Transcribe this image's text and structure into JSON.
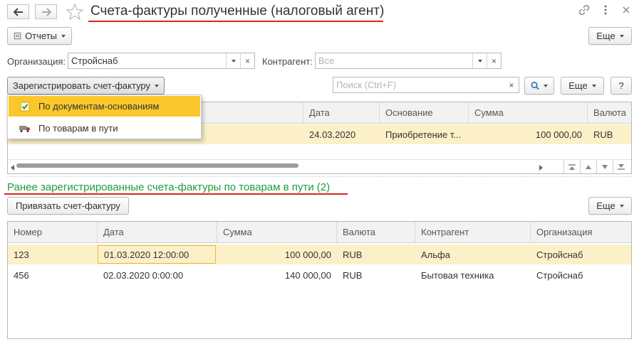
{
  "header": {
    "title": "Счета-фактуры полученные (налоговый агент)"
  },
  "toolbar1": {
    "reports_label": "Отчеты",
    "more_label": "Еще"
  },
  "filters": {
    "org_label": "Организация:",
    "org_value": "Стройснаб",
    "contractor_label": "Контрагент:",
    "contractor_placeholder": "Все"
  },
  "toolbar2": {
    "register_label": "Зарегистрировать счет-фактуру",
    "search_placeholder": "Поиск (Ctrl+F)",
    "more_label": "Еще",
    "help_label": "?"
  },
  "dropdown": {
    "items": [
      {
        "label": "По документам-основаниям",
        "icon": "check-doc-icon"
      },
      {
        "label": "По товарам в пути",
        "icon": "truck-icon"
      }
    ]
  },
  "grid1": {
    "columns": [
      "Дата",
      "Основание",
      "Сумма",
      "Валюта"
    ],
    "rows": [
      {
        "date": "24.03.2020",
        "basis": "Приобретение т...",
        "sum": "100 000,00",
        "currency": "RUB"
      }
    ]
  },
  "section": {
    "title": "Ранее зарегистрированные счета-фактуры по товарам в пути (2)"
  },
  "toolbar3": {
    "bind_label": "Привязать счет-фактуру",
    "more_label": "Еще"
  },
  "grid2": {
    "columns": [
      "Номер",
      "Дата",
      "Сумма",
      "Валюта",
      "Контрагент",
      "Организация"
    ],
    "rows": [
      {
        "number": "123",
        "date": "01.03.2020 12:00:00",
        "sum": "100 000,00",
        "currency": "RUB",
        "contractor": "Альфа",
        "org": "Стройснаб"
      },
      {
        "number": "456",
        "date": "02.03.2020 0:00:00",
        "sum": "140 000,00",
        "currency": "RUB",
        "contractor": "Бытовая техника",
        "org": "Стройснаб"
      }
    ]
  },
  "colors": {
    "accent_underline": "#d9261c",
    "section_link": "#1f9c3a",
    "selection_bg": "#fbf0c8",
    "menu_highlight": "#fbc82c"
  }
}
